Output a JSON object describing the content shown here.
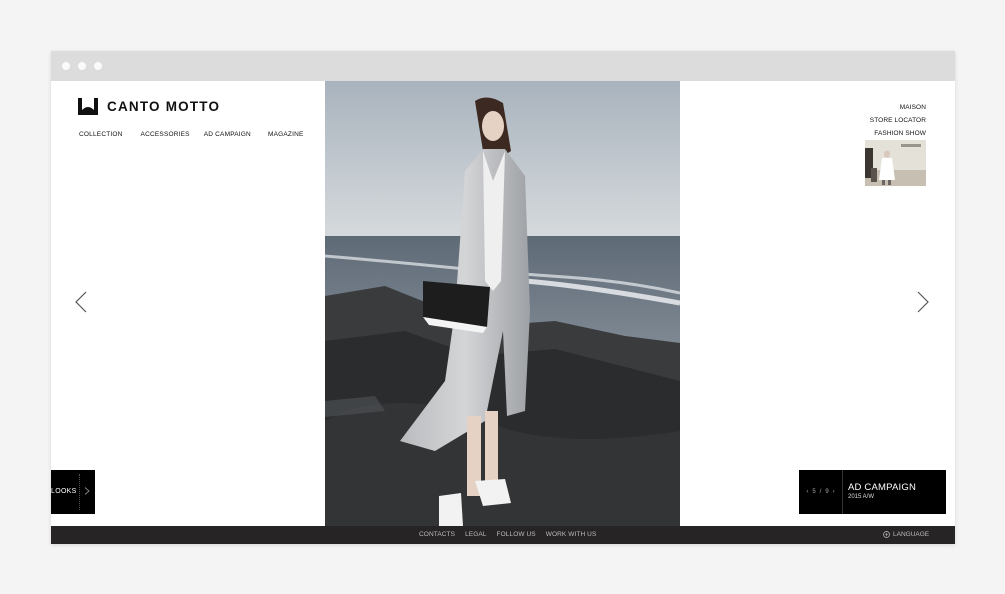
{
  "brand": {
    "name": "CANTO MOTTO"
  },
  "main_nav": [
    {
      "label": "COLLECTION"
    },
    {
      "label": "ACCESSORIES"
    },
    {
      "label": "AD CAMPAIGN"
    },
    {
      "label": "MAGAZINE"
    }
  ],
  "side_nav": [
    {
      "label": "MAISON"
    },
    {
      "label": "STORE LOCATOR"
    },
    {
      "label": "FASHION SHOW"
    }
  ],
  "looks": {
    "label": "LOOKS"
  },
  "campaign": {
    "current": "5",
    "separator": "/",
    "total": "9",
    "title": "AD CAMPAIGN",
    "subtitle": "2015 A/W"
  },
  "footer": {
    "links": [
      {
        "label": "CONTACTS"
      },
      {
        "label": "LEGAL"
      },
      {
        "label": "FOLLOW US"
      },
      {
        "label": "WORK WITH US"
      }
    ],
    "language": "LANGUAGE"
  },
  "icons": {
    "logo": "canto-motto-logo-icon",
    "prev": "chevron-left-icon",
    "next": "chevron-right-icon",
    "language": "globe-icon"
  },
  "colors": {
    "panel": "#000000",
    "footer": "#262424",
    "background": "#f4f4f4"
  }
}
